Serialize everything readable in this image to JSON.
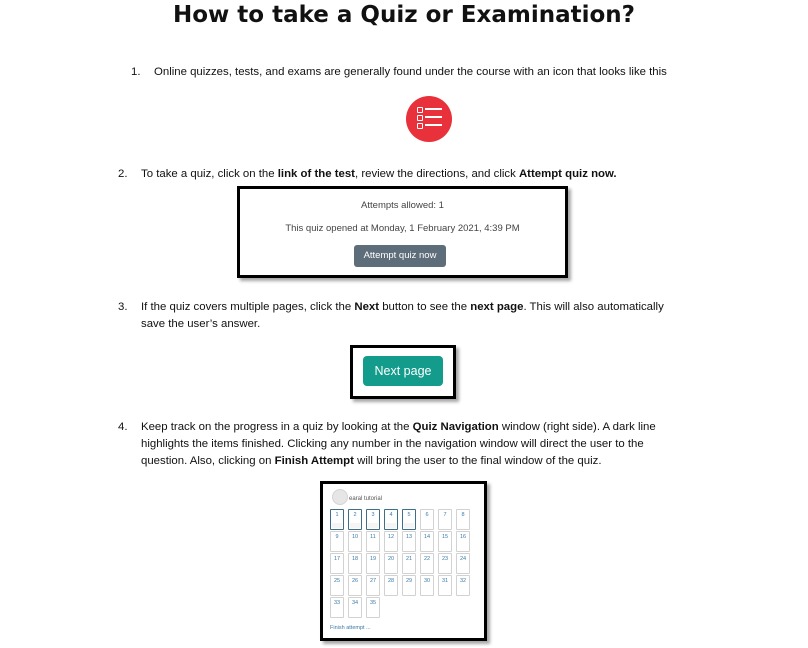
{
  "title": "How to take a Quiz or Examination?",
  "steps": [
    {
      "number": "1.",
      "text": "Online quizzes, tests, and exams are generally found under the course with an icon that looks like this"
    },
    {
      "number": "2.",
      "text_a": "To take a quiz, click on the ",
      "bold_a": "link of the test",
      "text_b": ", review the directions, and click ",
      "bold_b": "Attempt quiz now."
    },
    {
      "number": "3.",
      "text_a": "If the quiz covers multiple pages, click the ",
      "bold_a": "Next",
      "text_b": " button to see the ",
      "bold_b": "next page",
      "text_c": ". This will also automatically",
      "line2": "save the user’s answer."
    },
    {
      "number": "4.",
      "text_a": "Keep track on the progress in a quiz by looking at the ",
      "bold_a": "Quiz Navigation",
      "text_b": " window (right side). A dark line",
      "line2": "highlights the items finished. Clicking any number in the navigation window will direct the user to the",
      "line3_a": "question. Also, clicking on ",
      "bold_b": "Finish Attempt",
      "line3_b": " will bring the user to the final window of the quiz."
    }
  ],
  "quiz_icon": {
    "name": "quiz-list-icon",
    "color": "#e8313a"
  },
  "attempt": {
    "allowed": "Attempts allowed: 1",
    "opened": "This quiz opened at Monday, 1 February 2021, 4:39 PM",
    "button": "Attempt quiz now",
    "button_color": "#5e6d7a"
  },
  "next": {
    "button": "Next page",
    "button_color": "#139c8b"
  },
  "navigation": {
    "user": "earal tutorial",
    "finished": [
      1,
      2,
      3,
      4,
      5
    ],
    "numbers": [
      "1",
      "2",
      "3",
      "4",
      "5",
      "6",
      "7",
      "8",
      "9",
      "10",
      "11",
      "12",
      "13",
      "14",
      "15",
      "16",
      "17",
      "18",
      "19",
      "20",
      "21",
      "22",
      "23",
      "24",
      "25",
      "26",
      "27",
      "28",
      "29",
      "30",
      "31",
      "32",
      "33",
      "34",
      "35"
    ],
    "finish_link": "Finish attempt ..."
  }
}
